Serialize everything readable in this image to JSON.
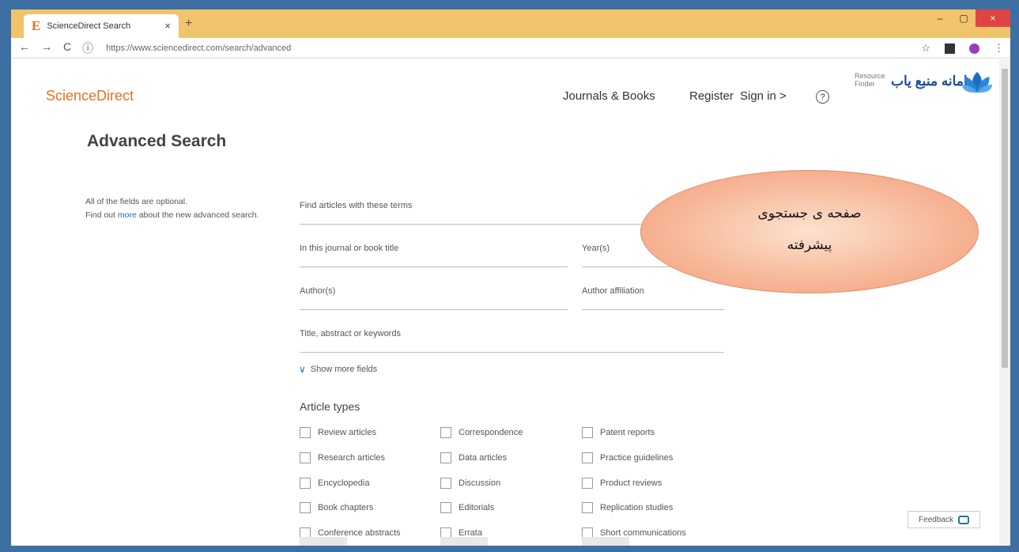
{
  "browser": {
    "tab_title": "ScienceDirect Search",
    "tab_logo": "E",
    "close_glyph": "×",
    "new_tab_glyph": "+",
    "url": "https://www.sciencedirect.com/search/advanced",
    "window_controls": [
      "–",
      "▢",
      "×"
    ]
  },
  "header": {
    "brand": "ScienceDirect",
    "nav": {
      "journals": "Journals & Books",
      "register": "Register",
      "signin": "Sign in >",
      "help": "?"
    },
    "resource_finder": {
      "en_line1": "Resource",
      "en_line2": "Finder",
      "fa_name": "سامانه منبع یاب"
    }
  },
  "page": {
    "title": "Advanced Search",
    "note_line1": "All of the fields are optional.",
    "note_line2_before": "Find out ",
    "note_link": "more",
    "note_line2_after": " about the new advanced search."
  },
  "fields": {
    "terms": "Find articles with these terms",
    "journal": "In this journal or book title",
    "year": "Year(s)",
    "author": "Author(s)",
    "affiliation": "Author affiliation",
    "title_abstract": "Title, abstract or keywords",
    "show_more": "Show more fields"
  },
  "article_types": {
    "heading": "Article types",
    "col1": [
      "Review articles",
      "Research articles",
      "Encyclopedia",
      "Book chapters",
      "Conference abstracts"
    ],
    "col2": [
      "Correspondence",
      "Data articles",
      "Discussion",
      "Editorials",
      "Errata"
    ],
    "col3": [
      "Patent reports",
      "Practice guidelines",
      "Product reviews",
      "Replication studies",
      "Short communications"
    ]
  },
  "feedback": "Feedback",
  "callout": {
    "line1": "صفحه ی جستجوی",
    "line2": "پیشرفته"
  }
}
